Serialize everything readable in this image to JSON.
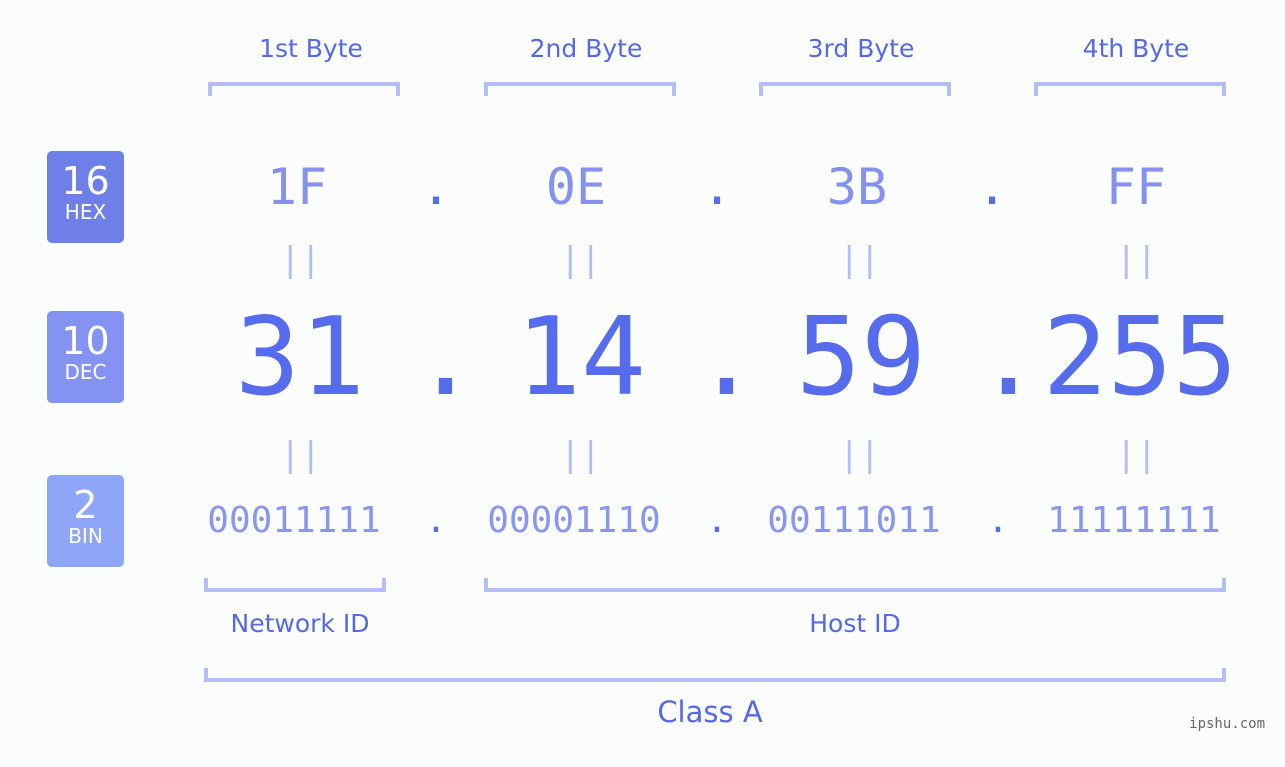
{
  "bytes": [
    {
      "label": "1st Byte",
      "hex": "1F",
      "dec": "31",
      "bin": "00011111"
    },
    {
      "label": "2nd Byte",
      "hex": "0E",
      "dec": "14",
      "bin": "00001110"
    },
    {
      "label": "3rd Byte",
      "hex": "3B",
      "dec": "59",
      "bin": "00111011"
    },
    {
      "label": "4th Byte",
      "hex": "FF",
      "dec": "255",
      "bin": "11111111"
    }
  ],
  "badges": {
    "hex": {
      "num": "16",
      "base": "HEX",
      "color": "#6f7fea"
    },
    "dec": {
      "num": "10",
      "base": "DEC",
      "color": "#8493f1"
    },
    "bin": {
      "num": "2",
      "base": "BIN",
      "color": "#8fa5f7"
    }
  },
  "separator": ".",
  "equals": "||",
  "network_id_label": "Network ID",
  "host_id_label": "Host ID",
  "class_label": "Class A",
  "watermark": "ipshu.com",
  "colors": {
    "primary": "#566ced",
    "bracket": "#b3bdf6",
    "hex_text": "#8591ee",
    "bin_text": "#8896f0"
  }
}
